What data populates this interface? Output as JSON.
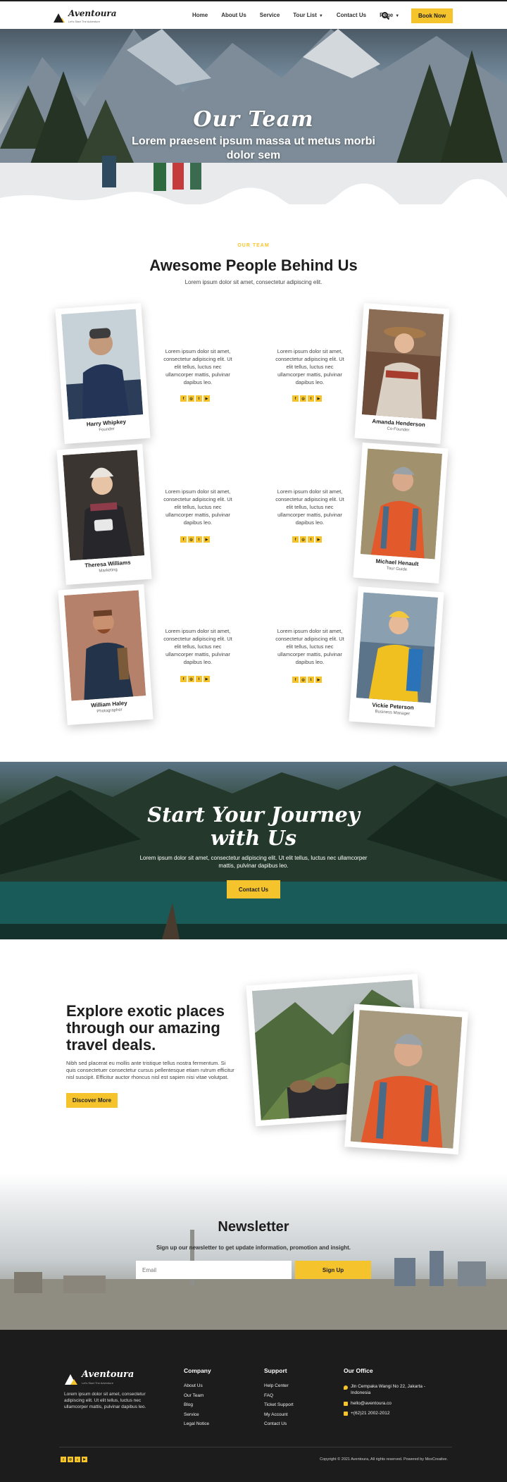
{
  "header": {
    "logo": "Aventoura",
    "logo_tagline": "Let's Start The Adventure",
    "nav": [
      "Home",
      "About Us",
      "Service",
      "Tour List",
      "Contact Us",
      "Page"
    ],
    "book_label": "Book Now"
  },
  "hero": {
    "title": "Our Team",
    "subtitle": "Lorem praesent ipsum massa ut metus morbi dolor sem"
  },
  "team_section": {
    "eyebrow": "OUR TEAM",
    "title": "Awesome People Behind Us",
    "subtitle": "Lorem ipsum dolor sit amet, consectetur adipiscing elit.",
    "bio": "Lorem ipsum dolor sit amet, consectetur adipiscing elit. Ut elit tellus, luctus nec ullamcorper mattis, pulvinar dapibus leo.",
    "social_icons": [
      "facebook-icon",
      "instagram-icon",
      "twitter-icon",
      "youtube-icon"
    ],
    "members": [
      {
        "name": "Harry Whipkey",
        "role": "Founder"
      },
      {
        "name": "Amanda Henderson",
        "role": "Co-Founder"
      },
      {
        "name": "Theresa Williams",
        "role": "Marketing"
      },
      {
        "name": "Michael Henault",
        "role": "Tour Guide"
      },
      {
        "name": "William Haley",
        "role": "Photographer"
      },
      {
        "name": "Vickie Peterson",
        "role": "Business Manager"
      }
    ]
  },
  "cta": {
    "title": "Start Your Journey with Us",
    "text": "Lorem ipsum dolor sit amet, consectetur adipiscing elit. Ut elit tellus, luctus nec ullamcorper mattis, pulvinar dapibus leo.",
    "button": "Contact Us"
  },
  "explore": {
    "title": "Explore exotic places through our amazing travel deals.",
    "text": "Nibh sed placerat eu mollis ante tristique tellus nostra fermentum. Si quis consectetuer consectetur cursus pellentesque etiam rutrum efficitur nisl suscipit. Efficitur auctor rhoncus nisl est sapien nisi vitae volutpat.",
    "button": "Discover More"
  },
  "newsletter": {
    "title": "Newsletter",
    "subtitle": "Sign up our newsletter to get update information, promotion and insight.",
    "placeholder": "Email",
    "button": "Sign Up"
  },
  "footer": {
    "logo": "Aventoura",
    "logo_tagline": "Let's Start The Adventure",
    "description": "Lorem ipsum dolor sit amet, consectetur adipiscing elit. Ut elit tellus, luctus nec ullamcorper mattis, pulvinar dapibus leo.",
    "company_title": "Company",
    "company_links": [
      "About Us",
      "Our Team",
      "Blog",
      "Service",
      "Legal Notice"
    ],
    "support_title": "Support",
    "support_links": [
      "Help Center",
      "FAQ",
      "Ticket Support",
      "My Account",
      "Contact Us"
    ],
    "office_title": "Our Office",
    "address": "Jln Cempaka Wangi No 22, Jakarta - Indonesia",
    "email": "hello@aventoura.co",
    "phone": "+(62)21 2002-2012",
    "copyright": "Copyright © 2021 Aventoura, All rights reserved. Powered by MoxCreative."
  },
  "colors": {
    "accent": "#f5c42c",
    "dark": "#1c1c1c"
  }
}
